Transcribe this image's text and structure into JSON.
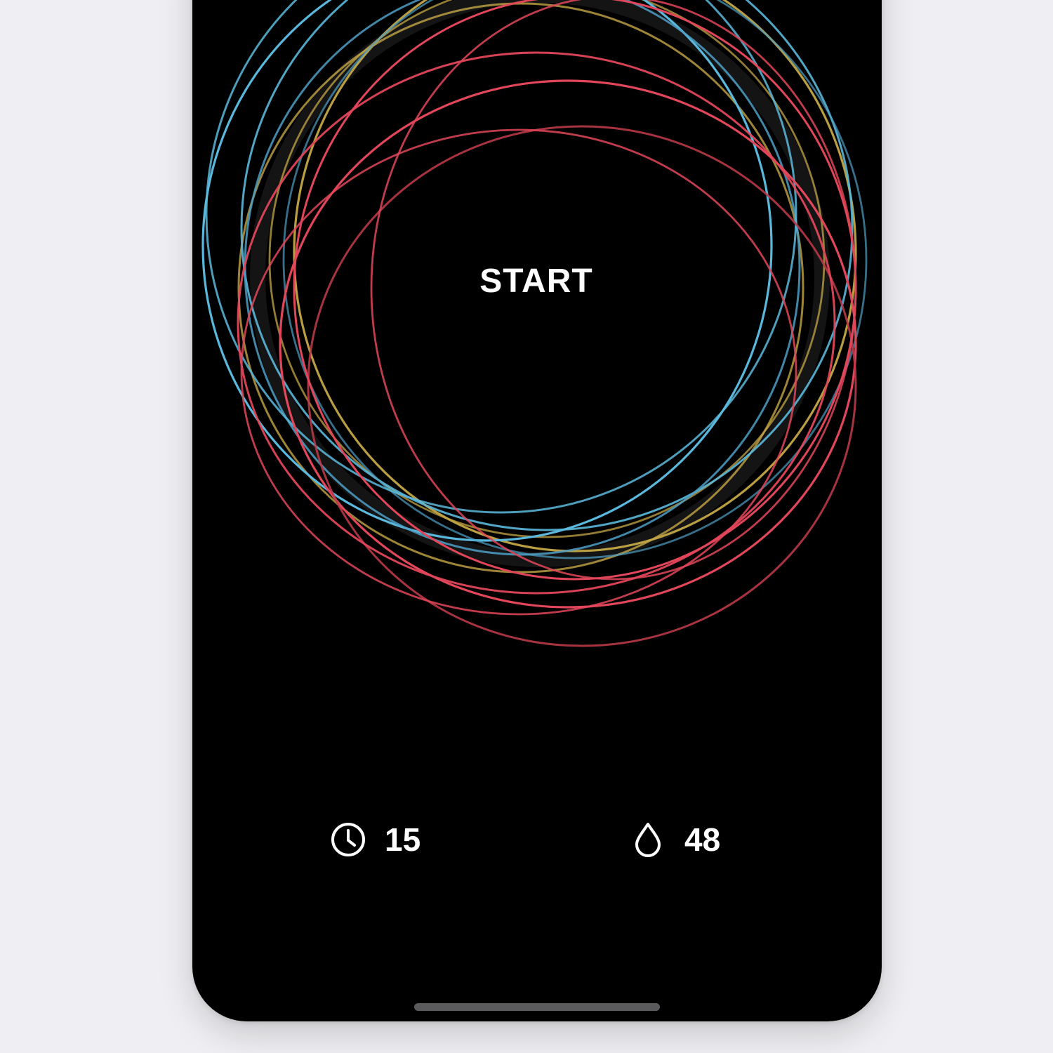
{
  "screen": {
    "start_label": "START"
  },
  "stats": {
    "duration": {
      "icon": "clock-icon",
      "value": "15"
    },
    "breaths": {
      "icon": "drop-icon",
      "value": "48"
    }
  },
  "colors": {
    "background": "#000000",
    "page_background": "#efeef2",
    "ring_blue": "#5ab8dc",
    "ring_red": "#e2465a",
    "ring_gold": "#c4a646",
    "text": "#ffffff",
    "home_indicator": "#5b5b5d"
  }
}
